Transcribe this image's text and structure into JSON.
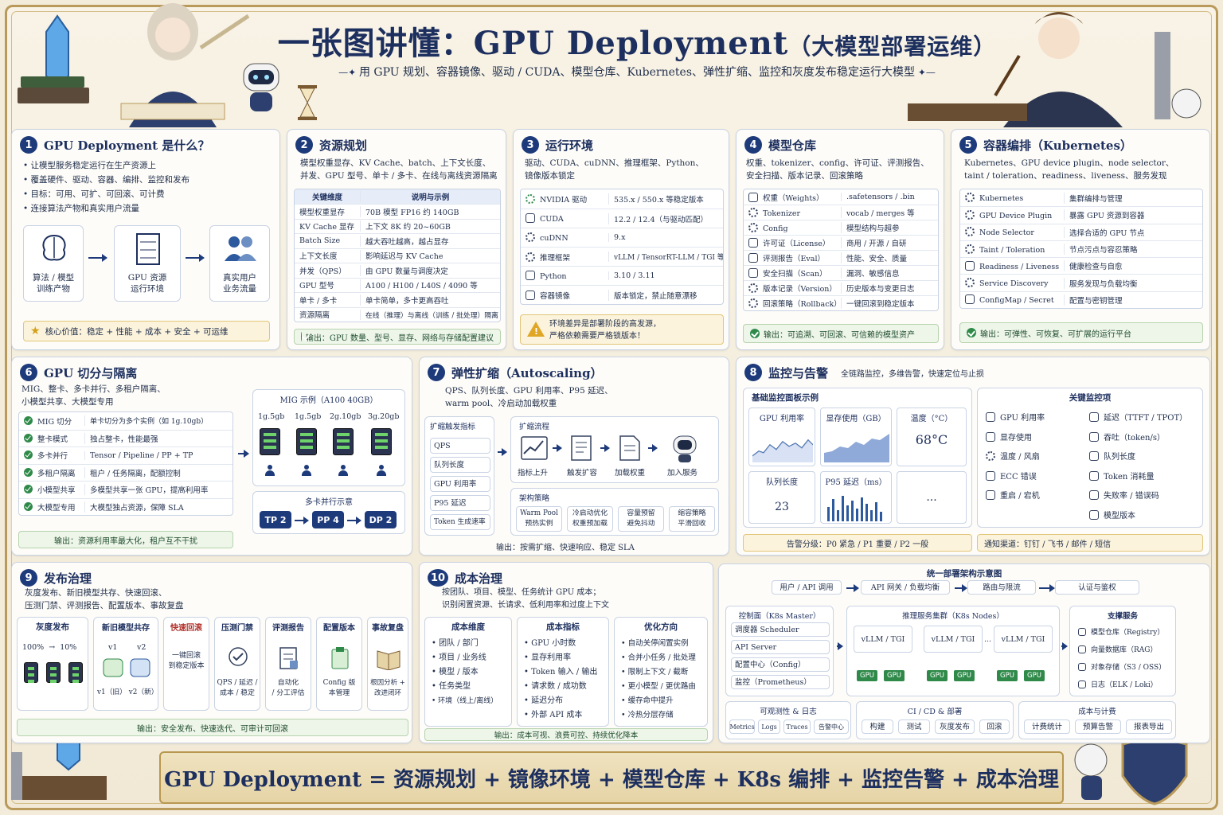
{
  "header": {
    "title_main": "一张图讲懂：GPU Deployment",
    "title_paren": "（大模型部署运维）",
    "subtitle": "用 GPU 规划、容器镜像、驱动 / CUDA、模型仓库、Kubernetes、弹性扩缩、监控和灰度发布稳定运行大模型"
  },
  "s1": {
    "num": "1",
    "title": "GPU Deployment 是什么？",
    "bullets": [
      "让模型服务稳定运行在生产资源上",
      "覆盖硬件、驱动、容器、编排、监控和发布",
      "目标：可用、可扩、可回滚、可计费",
      "连接算法产物和真实用户流量"
    ],
    "flow": [
      "算法 / 模型\n训练产物",
      "GPU 资源\n运行环境",
      "真实用户\n业务流量"
    ],
    "value": "核心价值：稳定 + 性能 + 成本 + 安全 + 可运维"
  },
  "s2": {
    "num": "2",
    "title": "资源规划",
    "desc": "模型权重显存、KV Cache、batch、上下文长度、\n并发、GPU 型号、单卡 / 多卡、在线与离线资源隔离",
    "head": [
      "关键维度",
      "说明与示例"
    ],
    "rows": [
      [
        "模型权重显存",
        "70B 模型 FP16 约 140GB"
      ],
      [
        "KV Cache 显存",
        "上下文 8K 约 20~60GB"
      ],
      [
        "Batch Size",
        "越大吞吐越高，越占显存"
      ],
      [
        "上下文长度",
        "影响延迟与 KV Cache"
      ],
      [
        "并发（QPS）",
        "由 GPU 数量与调度决定"
      ],
      [
        "GPU 型号",
        "A100 / H100 / L40S / 4090 等"
      ],
      [
        "单卡 / 多卡",
        "单卡简单，多卡更高吞吐"
      ],
      [
        "资源隔离",
        "在线（推理）与离线（训练 / 批处理）隔离"
      ]
    ],
    "output": "输出：GPU 数量、型号、显存、网络与存储配置建议"
  },
  "s3": {
    "num": "3",
    "title": "运行环境",
    "desc": "驱动、CUDA、cuDNN、推理框架、Python、\n镜像版本锁定",
    "rows": [
      [
        "NVIDIA 驱动",
        "535.x / 550.x 等稳定版本"
      ],
      [
        "CUDA",
        "12.2 / 12.4（与驱动匹配）"
      ],
      [
        "cuDNN",
        "9.x"
      ],
      [
        "推理框架",
        "vLLM / TensorRT-LLM / TGI 等"
      ],
      [
        "Python",
        "3.10 / 3.11"
      ],
      [
        "容器镜像",
        "版本锁定，禁止随意漂移"
      ]
    ],
    "warn": "环境差异是部署阶段的高发源，\n严格依赖需要严格锁版本！"
  },
  "s4": {
    "num": "4",
    "title": "模型仓库",
    "desc": "权重、tokenizer、config、许可证、评测报告、\n安全扫描、版本记录、回滚策略",
    "rows": [
      [
        "权重（Weights）",
        ".safetensors / .bin"
      ],
      [
        "Tokenizer",
        "vocab / merges 等"
      ],
      [
        "Config",
        "模型结构与超参"
      ],
      [
        "许可证（License）",
        "商用 / 开源 / 自研"
      ],
      [
        "评测报告（Eval）",
        "性能、安全、质量"
      ],
      [
        "安全扫描（Scan）",
        "漏洞、敏感信息"
      ],
      [
        "版本记录（Version）",
        "历史版本与变更日志"
      ],
      [
        "回滚策略（Rollback）",
        "一键回滚到稳定版本"
      ]
    ],
    "output": "输出：可追溯、可回滚、可信赖的模型资产"
  },
  "s5": {
    "num": "5",
    "title": "容器编排（Kubernetes）",
    "desc": "Kubernetes、GPU device plugin、node selector、\ntaint / toleration、readiness、liveness、服务发现",
    "rows": [
      [
        "Kubernetes",
        "集群编排与管理"
      ],
      [
        "GPU Device Plugin",
        "暴露 GPU 资源到容器"
      ],
      [
        "Node Selector",
        "选择合适的 GPU 节点"
      ],
      [
        "Taint / Toleration",
        "节点污点与容忍策略"
      ],
      [
        "Readiness / Liveness",
        "健康检查与自愈"
      ],
      [
        "Service Discovery",
        "服务发现与负载均衡"
      ],
      [
        "ConfigMap / Secret",
        "配置与密钥管理"
      ]
    ],
    "output": "输出：可弹性、可恢复、可扩展的运行平台"
  },
  "s6": {
    "num": "6",
    "title": "GPU 切分与隔离",
    "desc": "MIG、整卡、多卡并行、多租户隔离、\n小模型共享、大模型专用",
    "rows": [
      [
        "MIG 切分",
        "单卡切分为多个实例（如 1g.10gb）"
      ],
      [
        "整卡模式",
        "独占整卡，性能最强"
      ],
      [
        "多卡并行",
        "Tensor / Pipeline / PP + TP"
      ],
      [
        "多租户隔离",
        "租户 / 任务隔离，配额控制"
      ],
      [
        "小模型共享",
        "多模型共享一张 GPU，提高利用率"
      ],
      [
        "大模型专用",
        "大模型独占资源，保障 SLA"
      ]
    ],
    "mig_title": "MIG 示例（A100 40GB）",
    "mig": [
      "1g.5gb",
      "1g.5gb",
      "2g.10gb",
      "3g.20gb"
    ],
    "par_title": "多卡并行示意",
    "par": [
      "TP 2",
      "PP 4",
      "DP 2"
    ],
    "output": "输出：资源利用率最大化，租户互不干扰"
  },
  "s7": {
    "num": "7",
    "title": "弹性扩缩（Autoscaling）",
    "desc": "QPS、队列长度、GPU 利用率、P95 延迟、\nwarm pool、冷启动加载权重",
    "trig_title": "扩缩触发指标",
    "triggers": [
      "QPS",
      "队列长度",
      "GPU 利用率",
      "P95 延迟",
      "Token 生成速率"
    ],
    "flow_title": "扩缩流程",
    "flow": [
      "指标上升",
      "触发扩容",
      "加载权重",
      "加入服务"
    ],
    "arch_title": "架构策略",
    "arch": [
      "Warm Pool\n预热实例",
      "冷启动优化\n权重预加载",
      "容量预留\n避免抖动",
      "缩容策略\n平滑回收"
    ],
    "output": "输出：按需扩缩、快速响应、稳定 SLA"
  },
  "s8": {
    "num": "8",
    "title": "监控与告警",
    "subtitle": "全链路监控，多维告警，快速定位与止损",
    "dash_title": "基础监控面板示例",
    "panels": [
      "GPU 利用率",
      "显存使用（GB）",
      "温度（°C）",
      "队列长度",
      "P95 延迟（ms）"
    ],
    "temp": "68°C",
    "queue": "23",
    "more": "...",
    "key_title": "关键监控项",
    "keys_left": [
      "GPU 利用率",
      "显存使用",
      "温度 / 风扇",
      "ECC 错误",
      "重启 / 宕机"
    ],
    "keys_right": [
      "延迟（TTFT / TPOT）",
      "吞吐（token/s）",
      "队列长度",
      "Token 消耗量",
      "失败率 / 错误码",
      "模型版本"
    ],
    "alert": "告警分级：P0 紧急 / P1 重要 / P2 一般",
    "notify": "通知渠道：钉钉 / 飞书 / 邮件 / 短信"
  },
  "s9": {
    "num": "9",
    "title": "发布治理",
    "desc": "灰度发布、新旧模型共存、快速回滚、\n压测门禁、评测报告、配置版本、事故复盘",
    "cols": [
      {
        "h": "灰度发布",
        "t": "100%  →  10%"
      },
      {
        "h": "新旧模型共存",
        "t": "v1（旧）  v2（新）"
      },
      {
        "h": "快速回滚",
        "t": "一键回滚\n到稳定版本"
      },
      {
        "h": "压测门禁",
        "t": "QPS / 延迟 /\n成本 / 稳定"
      },
      {
        "h": "评测报告",
        "t": "自动化\n/ 分工评估"
      },
      {
        "h": "配置版本",
        "t": "Config 版\n本管理"
      },
      {
        "h": "事故复盘",
        "t": "根因分析 +\n改进闭环"
      }
    ],
    "v1": "v1",
    "v2": "v2",
    "output": "输出：安全发布、快速迭代、可审计可回滚"
  },
  "s10": {
    "num": "10",
    "title": "成本治理",
    "desc": "按团队、项目、模型、任务统计 GPU 成本；\n识别闲置资源、长请求、低利用率和过度上下文",
    "cols": [
      {
        "h": "成本维度",
        "items": [
          "团队 / 部门",
          "项目 / 业务线",
          "模型 / 版本",
          "任务类型",
          "环境（线上/离线）"
        ]
      },
      {
        "h": "成本指标",
        "items": [
          "GPU 小时数",
          "显存利用率",
          "Token 输入 / 输出",
          "请求数 / 成功数",
          "延迟分布",
          "外部 API 成本"
        ]
      },
      {
        "h": "优化方向",
        "items": [
          "自动关停闲置实例",
          "合并小任务 / 批处理",
          "限制上下文 / 截断",
          "更小模型 / 更优路由",
          "缓存命中提升",
          "冷热分层存储"
        ]
      }
    ],
    "output": "输出：成本可视、浪费可控、持续优化降本"
  },
  "arch": {
    "title": "统一部署架构示意图",
    "top": [
      "用户 / API 调用",
      "API 网关 / 负载均衡",
      "路由与限流",
      "认证与鉴权"
    ],
    "ctrl_title": "控制面（K8s Master）",
    "ctrl": [
      "调度器 Scheduler",
      "API Server",
      "配置中心（Config）",
      "监控（Prometheus）"
    ],
    "infer_title": "推理服务集群（K8s Nodes）",
    "pod": "vLLM / TGI",
    "gpu": "GPU",
    "dots": "...",
    "support_title": "支撑服务",
    "support": [
      "模型仓库（Registry）",
      "向量数据库（RAG）",
      "对象存储（S3 / OSS）",
      "日志（ELK / Loki）"
    ],
    "bottom": [
      {
        "h": "可观测性 & 日志",
        "items": [
          "Metrics",
          "Logs",
          "Traces",
          "告警中心"
        ]
      },
      {
        "h": "CI / CD & 部署",
        "items": [
          "构建",
          "测试",
          "灰度发布",
          "回滚"
        ]
      },
      {
        "h": "成本与计费",
        "items": [
          "计费统计",
          "预算告警",
          "报表导出"
        ]
      }
    ]
  },
  "footer": "GPU Deployment = 资源规划 + 镜像环境 + 模型仓库 + K8s 编排 + 监控告警 + 成本治理",
  "colors": {
    "navy": "#1d3a7a",
    "green": "#2f8a4a",
    "gold": "#b99a5a"
  }
}
